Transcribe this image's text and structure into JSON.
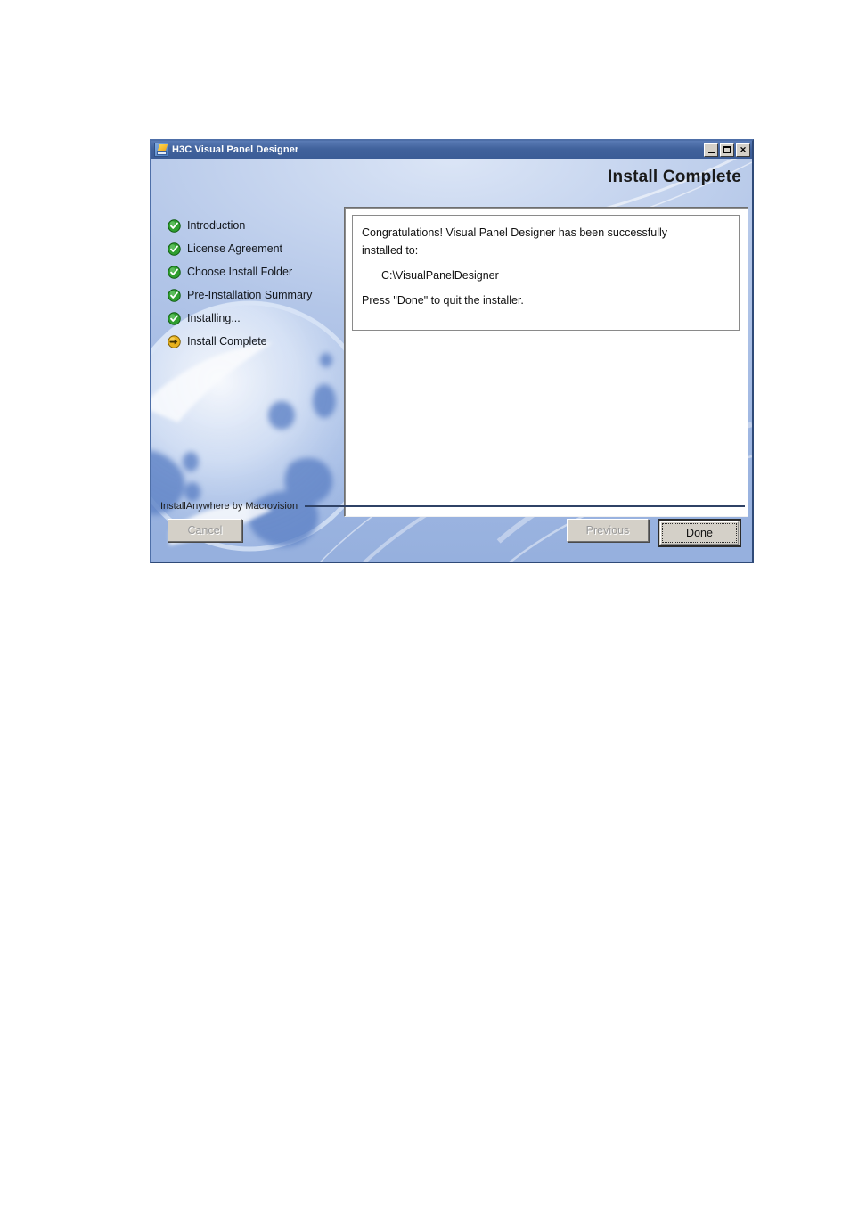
{
  "window": {
    "title": "H3C Visual Panel Designer",
    "icon": "app-icon",
    "controls": [
      {
        "name": "minimize",
        "label": "_"
      },
      {
        "name": "maximize",
        "label": "□"
      },
      {
        "name": "close",
        "label": "✕"
      }
    ]
  },
  "header": {
    "title": "Install Complete"
  },
  "steps": [
    {
      "label": "Introduction",
      "state": "complete",
      "icon": "check-circle-icon"
    },
    {
      "label": "License Agreement",
      "state": "complete",
      "icon": "check-circle-icon"
    },
    {
      "label": "Choose Install Folder",
      "state": "complete",
      "icon": "check-circle-icon"
    },
    {
      "label": "Pre-Installation Summary",
      "state": "complete",
      "icon": "check-circle-icon"
    },
    {
      "label": "Installing...",
      "state": "complete",
      "icon": "check-circle-icon"
    },
    {
      "label": "Install Complete",
      "state": "current",
      "icon": "arrow-circle-icon"
    }
  ],
  "content": {
    "line1": "Congratulations! Visual Panel Designer has been successfully",
    "line2": "installed to:",
    "install_path": "C:\\VisualPanelDesigner",
    "line4": "Press \"Done\" to quit the installer."
  },
  "footer": {
    "brand": "InstallAnywhere by Macrovision",
    "buttons": {
      "cancel": "Cancel",
      "previous": "Previous",
      "done": "Done"
    }
  },
  "colors": {
    "titlebar_blue": "#41629c",
    "panel_blue": "#a9bfe6",
    "step_complete_green": "#2f9e2f",
    "step_current_amber": "#e8b21e",
    "button_face": "#d4d0c8"
  }
}
